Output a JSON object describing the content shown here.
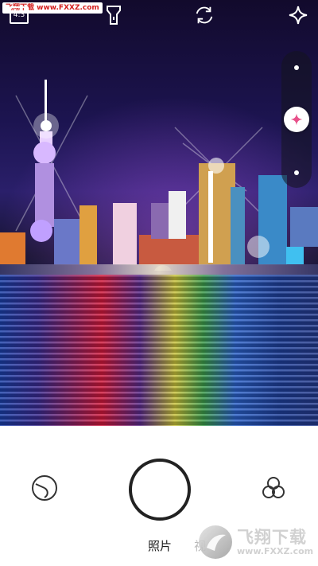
{
  "watermark": {
    "text": "飞翔下载 www.FXXZ.com"
  },
  "top_bar": {
    "aspect_ratio": "4:3",
    "icons": [
      "flashlight-icon",
      "switch-camera-icon",
      "sparkle-effect-icon"
    ]
  },
  "exposure_slider": {
    "level": 0.5,
    "knob_icon": "sparkle-icon",
    "accent_color": "#e8508a"
  },
  "bottom_bar": {
    "mode_label": "照片",
    "next_mode_label_partial": "视",
    "left_icon": "filter-dial-icon",
    "right_icon": "color-circles-icon"
  },
  "logo_watermark": {
    "name": "飞翔下载",
    "url": "www.FXXZ.com"
  }
}
